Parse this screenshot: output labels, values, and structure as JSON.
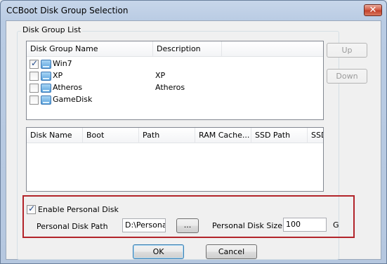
{
  "window": {
    "title": "CCBoot Disk Group Selection",
    "close_glyph": "✕"
  },
  "group_box": {
    "label": "Disk Group List"
  },
  "disk_group_list": {
    "columns": [
      "Disk Group Name",
      "Description"
    ],
    "rows": [
      {
        "name": "Win7",
        "description": "",
        "checked": true
      },
      {
        "name": "XP",
        "description": "XP",
        "checked": false
      },
      {
        "name": "Atheros",
        "description": "Atheros",
        "checked": false
      },
      {
        "name": "GameDisk",
        "description": "",
        "checked": false
      }
    ]
  },
  "disk_list": {
    "columns": [
      "Disk Name",
      "Boot",
      "Path",
      "RAM Cache...",
      "SSD Path",
      "SSD"
    ]
  },
  "side_buttons": {
    "up": "Up",
    "down": "Down"
  },
  "personal_disk": {
    "enable_label": "Enable Personal Disk",
    "enabled": true,
    "path_label": "Personal Disk Path",
    "path_value": "D:\\Personal",
    "browse_label": "...",
    "size_label": "Personal Disk Size",
    "size_value": "100",
    "size_unit": "G"
  },
  "footer": {
    "ok": "OK",
    "cancel": "Cancel"
  }
}
